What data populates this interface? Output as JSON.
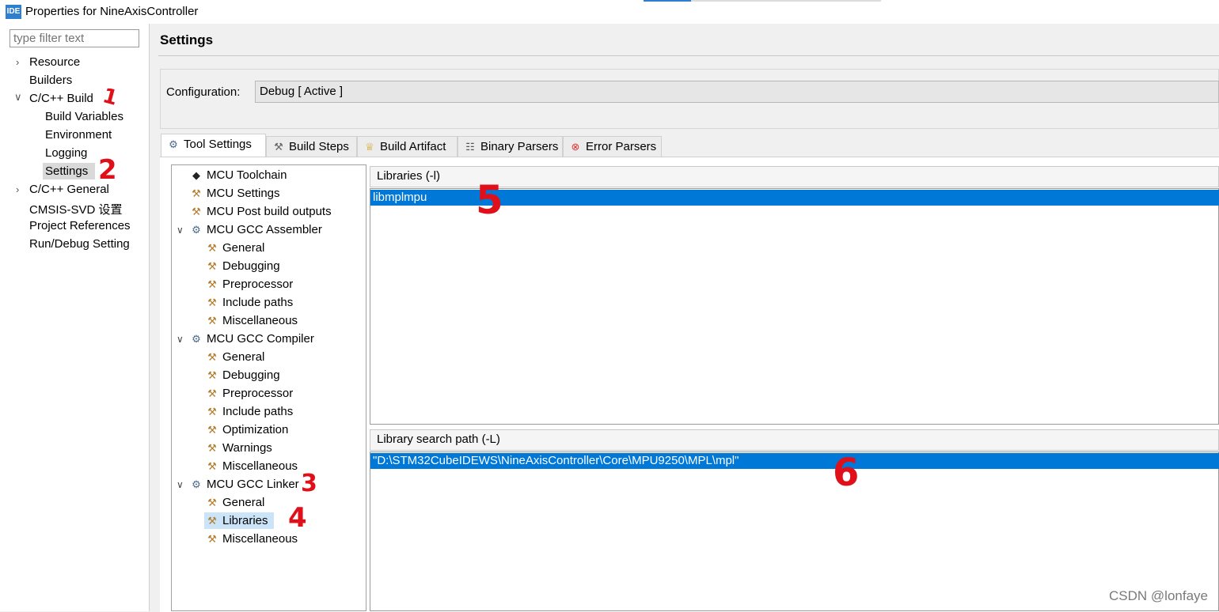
{
  "window": {
    "icon_text": "IDE",
    "title": "Properties for NineAxisController"
  },
  "filter": {
    "placeholder": "type filter text"
  },
  "nav": {
    "resource": "Resource",
    "builders": "Builders",
    "cpp_build": "C/C++ Build",
    "build_variables": "Build Variables",
    "environment": "Environment",
    "logging": "Logging",
    "settings": "Settings",
    "cpp_general": "C/C++ General",
    "cmsis_svd": "CMSIS-SVD 设置",
    "project_references": "Project References",
    "run_debug": "Run/Debug Setting"
  },
  "main": {
    "title": "Settings",
    "config_label": "Configuration:",
    "config_value": "Debug  [ Active ]"
  },
  "tabs": {
    "tool_settings": "Tool Settings",
    "build_steps": "Build Steps",
    "build_artifact": "Build Artifact",
    "binary_parsers": "Binary Parsers",
    "error_parsers": "Error Parsers"
  },
  "tree": {
    "mcu_toolchain": "MCU Toolchain",
    "mcu_settings": "MCU Settings",
    "mcu_post_build": "MCU Post build outputs",
    "assembler": "MCU GCC Assembler",
    "asm_general": "General",
    "asm_debugging": "Debugging",
    "asm_preprocessor": "Preprocessor",
    "asm_include_paths": "Include paths",
    "asm_misc": "Miscellaneous",
    "compiler": "MCU GCC Compiler",
    "cc_general": "General",
    "cc_debugging": "Debugging",
    "cc_preprocessor": "Preprocessor",
    "cc_include_paths": "Include paths",
    "cc_optimization": "Optimization",
    "cc_warnings": "Warnings",
    "cc_misc": "Miscellaneous",
    "linker": "MCU GCC Linker",
    "ld_general": "General",
    "ld_libraries": "Libraries",
    "ld_misc": "Miscellaneous"
  },
  "libraries": {
    "title": "Libraries (-l)",
    "items": [
      "libmplmpu"
    ]
  },
  "library_paths": {
    "title": "Library search path (-L)",
    "items": [
      "\"D:\\STM32CubeIDEWS\\NineAxisController\\Core\\MPU9250\\MPL\\mpl\""
    ]
  },
  "annotations": [
    "1",
    "2",
    "3",
    "4",
    "5",
    "6"
  ],
  "watermark": "CSDN @lonfaye",
  "colors": {
    "selection": "#0078d7",
    "annotation": "#e0101a",
    "tree_selection": "#cce4f7"
  }
}
